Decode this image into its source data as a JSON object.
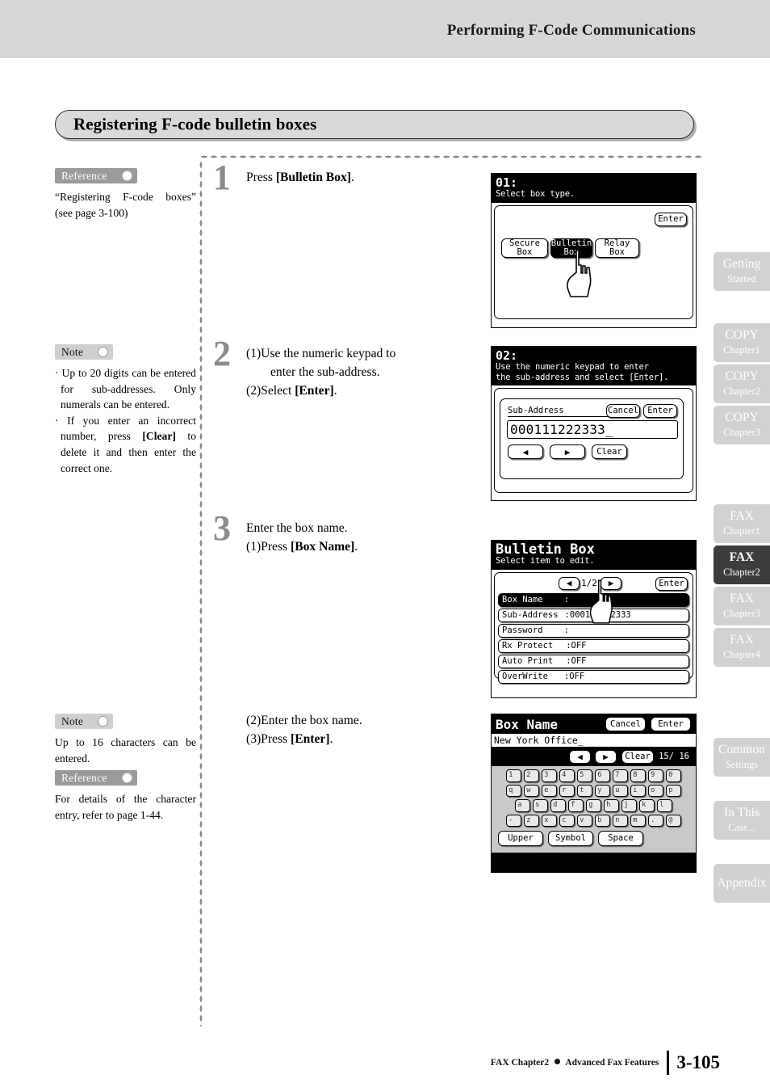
{
  "header": {
    "title": "Performing F-Code Communications"
  },
  "heading": {
    "title": "Registering F-code bulletin boxes"
  },
  "annotations": {
    "reference1": {
      "tag": "Reference",
      "text": "“Registering F-code boxes” (see page 3-100)"
    },
    "note1": {
      "tag": "Note",
      "bullet1": "Up to 20 digits can be entered for sub-addresses. Only numerals can be entered.",
      "bullet2_a": "If you enter an incorrect number, press ",
      "bullet2_b": "[Clear]",
      "bullet2_c": " to delete it and then enter the correct one."
    },
    "note2": {
      "tag": "Note",
      "text": "Up to 16 characters can be entered."
    },
    "reference2": {
      "tag": "Reference",
      "text": "For details of the character entry, refer to page 1-44."
    }
  },
  "steps": [
    {
      "number": "1",
      "line1_a": "Press ",
      "line1_b": "[Bulletin Box]",
      "line1_c": "."
    },
    {
      "number": "2",
      "line1": "(1)Use the numeric keypad to",
      "line2": "enter the sub-address.",
      "line3_a": "(2)Select ",
      "line3_b": "[Enter]",
      "line3_c": "."
    },
    {
      "number": "3",
      "line1": "Enter the box name.",
      "line2_a": "(1)Press ",
      "line2_b": "[Box Name]",
      "line2_c": "."
    },
    {
      "number": "",
      "line1": "(2)Enter the box name.",
      "line2_a": "(3)Press ",
      "line2_b": "[Enter]",
      "line2_c": "."
    }
  ],
  "lcd1": {
    "title": "01:",
    "subtitle": "Select box type.",
    "enter": "Enter",
    "buttons": [
      "Secure Box",
      "Bulletin Box",
      "Relay Box"
    ],
    "selected": "Bulletin Box"
  },
  "lcd2": {
    "title": "02:",
    "subtitle_line1": "Use the numeric keypad to enter",
    "subtitle_line2": "the sub-address and select [Enter].",
    "field_label": "Sub-Address",
    "cancel": "Cancel",
    "enter": "Enter",
    "value": "000111222333_",
    "left_arrow": "◀",
    "right_arrow": "▶",
    "clear": "Clear"
  },
  "lcd3": {
    "title": "Bulletin Box",
    "subtitle": "Select item to edit.",
    "left_arrow": "◀",
    "right_arrow": "▶",
    "page": "1/2",
    "enter": "Enter",
    "rows": [
      {
        "label": "Box Name",
        "value": ":",
        "selected": true
      },
      {
        "label": "Sub-Address",
        "value": ":000111222333",
        "selected": false
      },
      {
        "label": "Password",
        "value": ":",
        "selected": false
      },
      {
        "label": "Rx Protect",
        "value": ":OFF",
        "selected": false
      },
      {
        "label": "Auto Print",
        "value": ":OFF",
        "selected": false
      },
      {
        "label": "OverWrite",
        "value": ":OFF",
        "selected": false
      }
    ]
  },
  "lcd4": {
    "title": "Box Name",
    "cancel": "Cancel",
    "enter": "Enter",
    "value": "New York Office_",
    "left_arrow": "◀",
    "right_arrow": "▶",
    "clear": "Clear",
    "counter": "15/ 16",
    "keys_row1": [
      "1",
      "2",
      "3",
      "4",
      "5",
      "6",
      "7",
      "8",
      "9",
      "0"
    ],
    "keys_row2": [
      "q",
      "w",
      "e",
      "r",
      "t",
      "y",
      "u",
      "i",
      "o",
      "p"
    ],
    "keys_row3": [
      "a",
      "s",
      "d",
      "f",
      "g",
      "h",
      "j",
      "k",
      "l"
    ],
    "keys_row4": [
      "-",
      "z",
      "x",
      "c",
      "v",
      "b",
      "n",
      "m",
      ".",
      "@"
    ],
    "fn_keys": [
      "Upper",
      "Symbol",
      "Space"
    ]
  },
  "tabs": [
    {
      "t1": "Getting",
      "t2": "Started",
      "active": false
    },
    {
      "t1": "COPY",
      "t2": "Chapter1",
      "active": false
    },
    {
      "t1": "COPY",
      "t2": "Chapter2",
      "active": false
    },
    {
      "t1": "COPY",
      "t2": "Chapter3",
      "active": false
    },
    {
      "t1": "FAX",
      "t2": "Chapter1",
      "active": false
    },
    {
      "t1": "FAX",
      "t2": "Chapter2",
      "active": true
    },
    {
      "t1": "FAX",
      "t2": "Chapter3",
      "active": false
    },
    {
      "t1": "FAX",
      "t2": "Chapter4",
      "active": false
    },
    {
      "t1": "Common",
      "t2": "Settings",
      "active": false
    },
    {
      "t1": "In This",
      "t2": "Case...",
      "active": false
    },
    {
      "t1": "Appendix",
      "t2": "",
      "active": false
    }
  ],
  "footer": {
    "chapter": "FAX Chapter2",
    "section": "Advanced Fax Features",
    "page": "3-105"
  }
}
